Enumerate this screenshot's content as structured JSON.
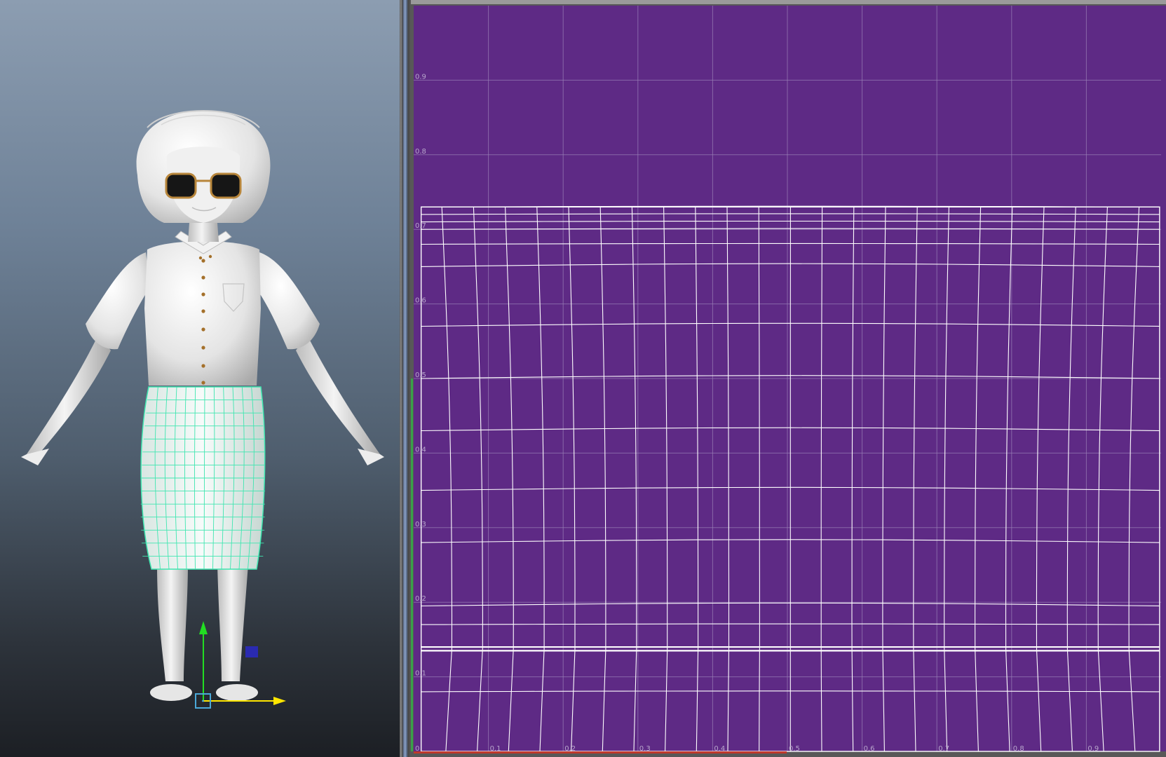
{
  "viewport": {
    "panel": "3d-perspective-view",
    "colors": {
      "bg_top": "#8c9db1",
      "bg_bottom": "#1c1f24",
      "mesh_wire": "#3fe6b0",
      "skin": "#e9e9e9"
    },
    "manipulator": {
      "y_axis_color": "#22dd22",
      "x_axis_color": "#ffe600",
      "z_handle_color": "#2a2ab0",
      "pivot_color": "#4aa8d8"
    }
  },
  "uv_editor": {
    "colors": {
      "uv_bg": "#5e2a85",
      "grid_line": "#9a80b6",
      "uv_shell": "#ffffff",
      "tick": "#b8a6cc",
      "u_axis": "#c0392b"
    },
    "v_ticks": [
      "0.9",
      "0.8",
      "0.7",
      "0.6",
      "0.5",
      "0.4",
      "0.3",
      "0.2",
      "0.1"
    ],
    "u_ticks": [
      "0",
      "0.1",
      "0.2",
      "0.3",
      "0.4",
      "0.5",
      "0.6",
      "0.7",
      "0.8",
      "0.9"
    ],
    "shell": {
      "u_range": [
        0.01,
        0.998
      ],
      "v_range": [
        0.0,
        0.73
      ],
      "waist_seam_v": [
        0.14,
        0.135
      ],
      "rows_v": [
        0.73,
        0.72,
        0.71,
        0.7,
        0.68,
        0.65,
        0.57,
        0.5,
        0.43,
        0.35,
        0.28,
        0.195,
        0.17,
        0.08
      ]
    }
  }
}
